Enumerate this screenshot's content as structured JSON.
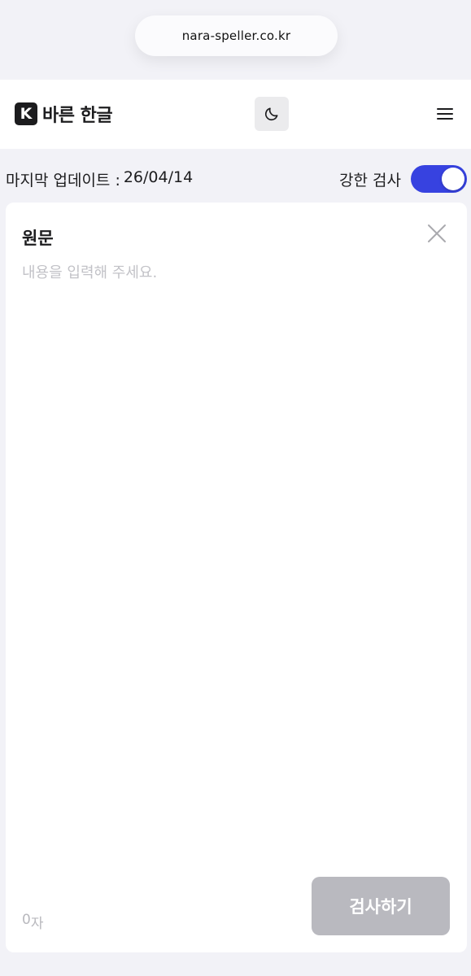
{
  "browser": {
    "url": "nara-speller.co.kr"
  },
  "header": {
    "logo_mark": "K",
    "logo_text": "바른 한글",
    "theme_icon": "moon-icon",
    "menu_icon": "hamburger-menu-icon"
  },
  "info": {
    "last_update_label": "마지막 업데이트 :",
    "last_update_value": "26/04/14",
    "strong_check_label": "강한 검사",
    "strong_check_enabled": true
  },
  "colors": {
    "accent": "#3742e0",
    "button_disabled": "#b9b9bf",
    "background": "#f2f2f7"
  },
  "editor": {
    "title": "원문",
    "placeholder": "내용을 입력해 주세요.",
    "value": "",
    "char_count": "0",
    "char_unit": "자",
    "clear_icon": "close-icon",
    "submit_label": "검사하기"
  }
}
